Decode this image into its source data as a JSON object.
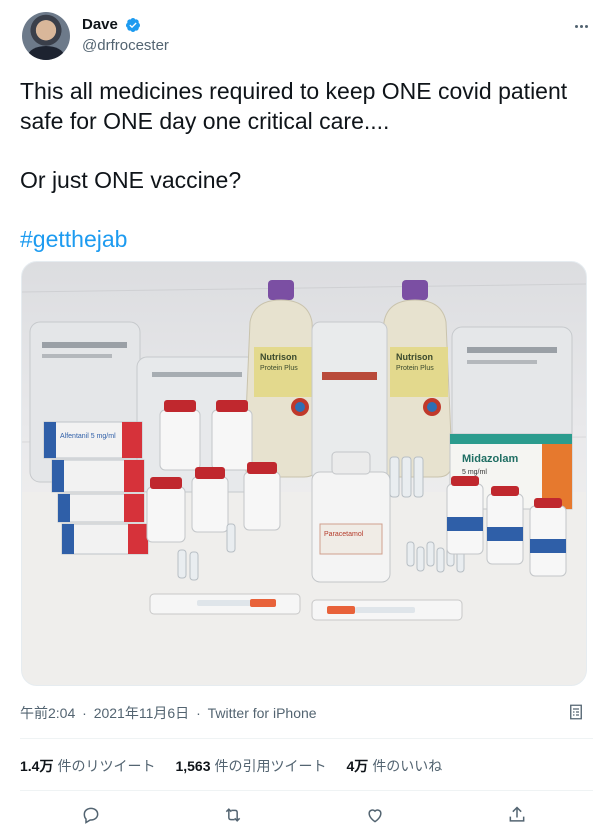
{
  "author": {
    "display_name": "Dave",
    "handle": "@drfrocester",
    "verified": true
  },
  "tweet": {
    "line1": "This all medicines required to keep ONE covid patient",
    "line2": "safe for ONE day one critical care....",
    "line3": "Or just ONE vaccine?",
    "hashtag": "#getthejab"
  },
  "media": {
    "labels": {
      "alfentanil": "Alfentanil 5 mg/ml",
      "midazolam": "Midazolam",
      "midazolam_sub": "5 mg/ml",
      "nutrison1": "Nutrison",
      "nutrison1_sub": "Protein Plus",
      "nutrison2": "Nutrison",
      "nutrison2_sub": "Protein Plus",
      "paracetamol": "Paracetamol"
    }
  },
  "meta": {
    "time": "午前2:04",
    "date": "2021年11月6日",
    "source": "Twitter for iPhone",
    "separator": "·"
  },
  "stats": {
    "retweets_count": "1.4万",
    "retweets_label": "件のリツイート",
    "quotes_count": "1,563",
    "quotes_label": "件の引用ツイート",
    "likes_count": "4万",
    "likes_label": "件のいいね"
  },
  "colors": {
    "link": "#1d9bf0",
    "secondary_text": "#536471",
    "primary_text": "#0f1419"
  }
}
